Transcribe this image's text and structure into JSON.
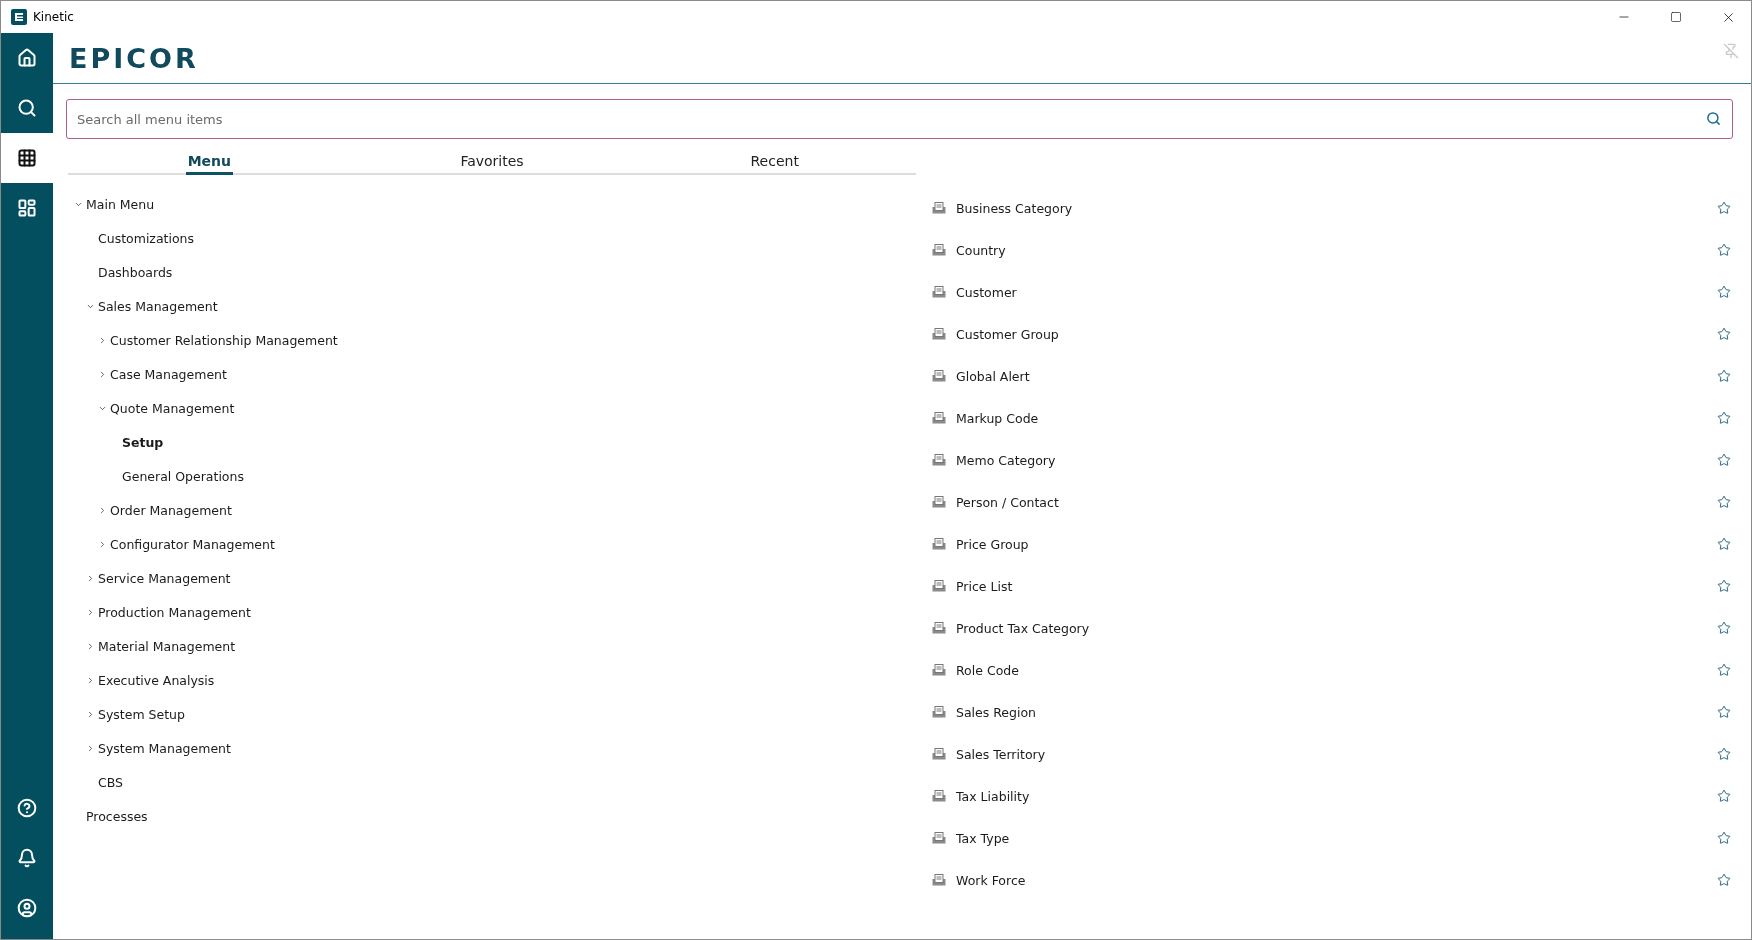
{
  "window": {
    "title": "Kinetic"
  },
  "sidebar": {
    "top": [
      {
        "kind": "home",
        "selected": false
      },
      {
        "kind": "search",
        "selected": false
      },
      {
        "kind": "apps",
        "selected": true
      },
      {
        "kind": "dashboard",
        "selected": false
      }
    ],
    "bottom": [
      {
        "kind": "help",
        "selected": false
      },
      {
        "kind": "bell",
        "selected": false
      },
      {
        "kind": "user",
        "selected": false
      }
    ]
  },
  "logo": "EPICOR",
  "search": {
    "placeholder": "Search all menu items"
  },
  "tabs": [
    {
      "label": "Menu",
      "selected": true
    },
    {
      "label": "Favorites",
      "selected": false
    },
    {
      "label": "Recent",
      "selected": false
    }
  ],
  "tree": [
    {
      "label": "Main Menu",
      "selected": false,
      "expanded": true,
      "children": [
        {
          "label": "Customizations",
          "selected": false
        },
        {
          "label": "Dashboards",
          "selected": false
        },
        {
          "label": "Sales Management",
          "selected": false,
          "expanded": true,
          "children": [
            {
              "label": "Customer Relationship Management",
              "selected": false,
              "expanded": false
            },
            {
              "label": "Case Management",
              "selected": false,
              "expanded": false
            },
            {
              "label": "Quote Management",
              "selected": false,
              "expanded": true,
              "children": [
                {
                  "label": "Setup",
                  "selected": true
                },
                {
                  "label": "General Operations",
                  "selected": false
                }
              ]
            },
            {
              "label": "Order Management",
              "selected": false,
              "expanded": false
            },
            {
              "label": "Configurator Management",
              "selected": false,
              "expanded": false
            }
          ]
        },
        {
          "label": "Service Management",
          "selected": false,
          "expanded": false
        },
        {
          "label": "Production Management",
          "selected": false,
          "expanded": false
        },
        {
          "label": "Material Management",
          "selected": false,
          "expanded": false
        },
        {
          "label": "Executive Analysis",
          "selected": false,
          "expanded": false
        },
        {
          "label": "System Setup",
          "selected": false,
          "expanded": false
        },
        {
          "label": "System Management",
          "selected": false,
          "expanded": false
        },
        {
          "label": "CBS",
          "selected": false
        }
      ]
    },
    {
      "label": "Processes",
      "selected": false
    }
  ],
  "items": [
    {
      "label": "Business Category",
      "favorite": false
    },
    {
      "label": "Country",
      "favorite": false
    },
    {
      "label": "Customer",
      "favorite": false
    },
    {
      "label": "Customer Group",
      "favorite": false
    },
    {
      "label": "Global Alert",
      "favorite": false
    },
    {
      "label": "Markup Code",
      "favorite": false
    },
    {
      "label": "Memo Category",
      "favorite": false
    },
    {
      "label": "Person / Contact",
      "favorite": false
    },
    {
      "label": "Price Group",
      "favorite": false
    },
    {
      "label": "Price List",
      "favorite": false
    },
    {
      "label": "Product Tax Category",
      "favorite": false
    },
    {
      "label": "Role Code",
      "favorite": false
    },
    {
      "label": "Sales Region",
      "favorite": false
    },
    {
      "label": "Sales Territory",
      "favorite": false
    },
    {
      "label": "Tax Liability",
      "favorite": false
    },
    {
      "label": "Tax Type",
      "favorite": false
    },
    {
      "label": "Work Force",
      "favorite": false
    }
  ]
}
